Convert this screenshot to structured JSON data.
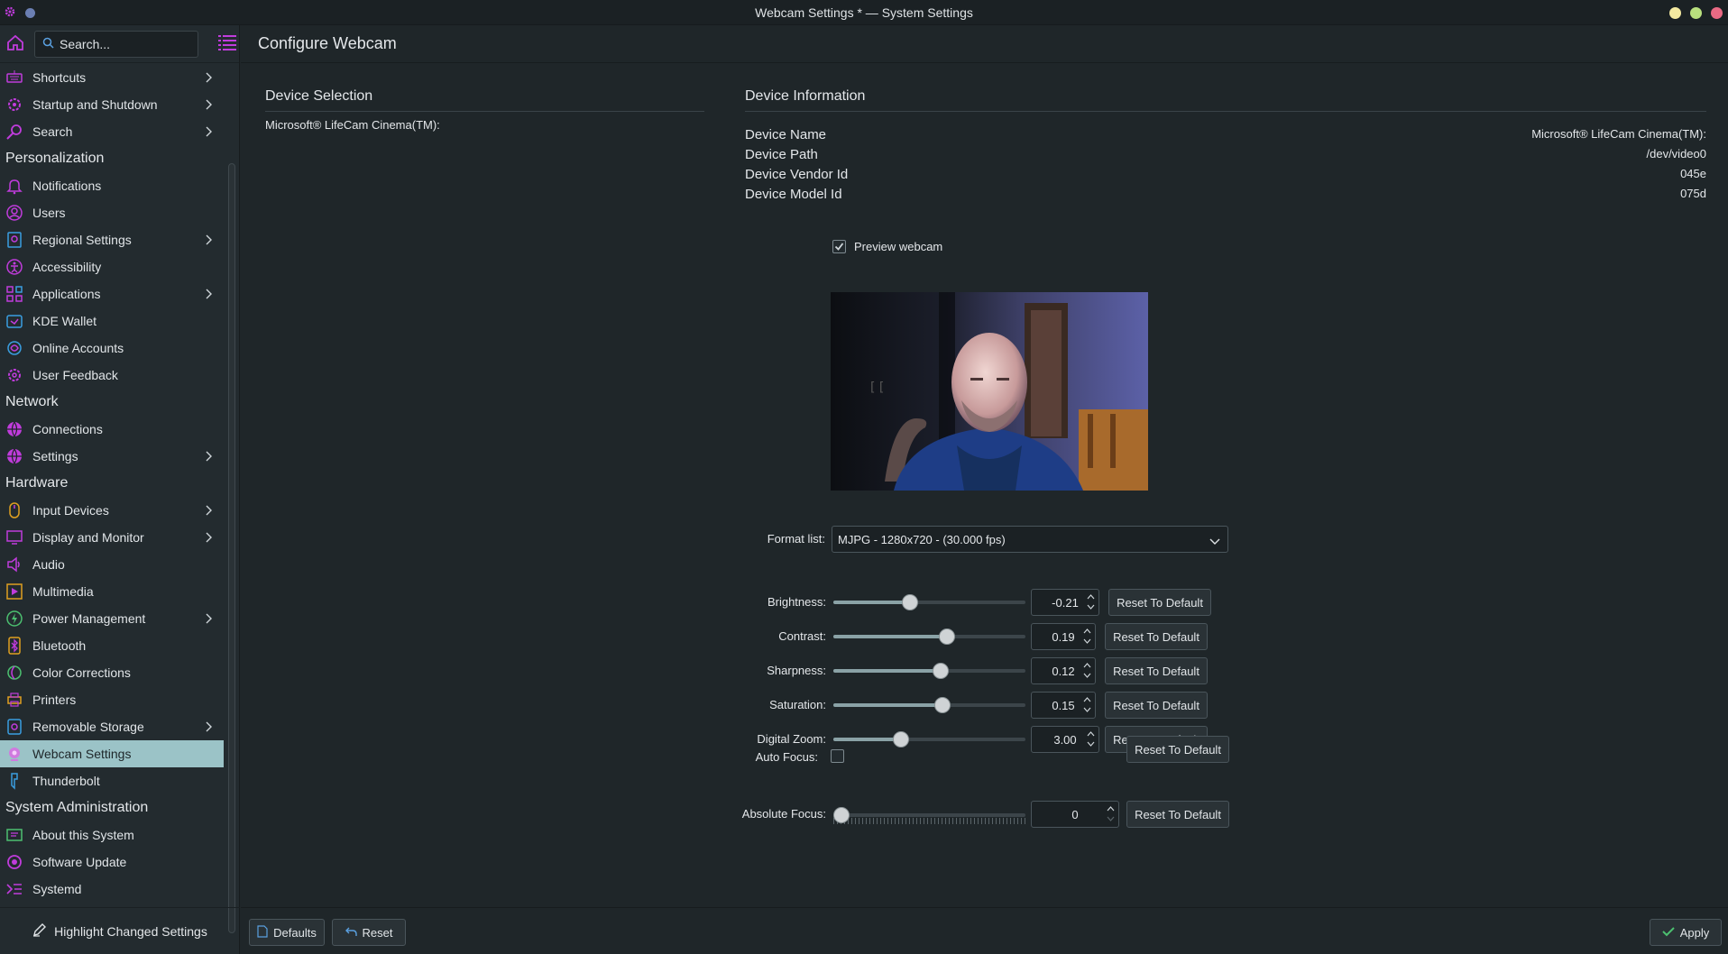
{
  "window": {
    "title": "Webcam Settings * — System Settings"
  },
  "sidebar": {
    "search_placeholder": "Search...",
    "items": [
      {
        "type": "item",
        "label": "Shortcuts",
        "icon": "keyboard-icon",
        "chevron": true
      },
      {
        "type": "item",
        "label": "Startup and Shutdown",
        "icon": "power-gear-icon",
        "chevron": true
      },
      {
        "type": "item",
        "label": "Search",
        "icon": "magnifier-icon",
        "chevron": true
      },
      {
        "type": "category",
        "label": "Personalization"
      },
      {
        "type": "item",
        "label": "Notifications",
        "icon": "bell-icon",
        "chevron": false
      },
      {
        "type": "item",
        "label": "Users",
        "icon": "user-icon",
        "chevron": false
      },
      {
        "type": "item",
        "label": "Regional Settings",
        "icon": "regional-icon",
        "chevron": true
      },
      {
        "type": "item",
        "label": "Accessibility",
        "icon": "accessibility-icon",
        "chevron": false
      },
      {
        "type": "item",
        "label": "Applications",
        "icon": "apps-grid-icon",
        "chevron": true
      },
      {
        "type": "item",
        "label": "KDE Wallet",
        "icon": "wallet-icon",
        "chevron": false
      },
      {
        "type": "item",
        "label": "Online Accounts",
        "icon": "online-accounts-icon",
        "chevron": false
      },
      {
        "type": "item",
        "label": "User Feedback",
        "icon": "feedback-icon",
        "chevron": false
      },
      {
        "type": "category",
        "label": "Network"
      },
      {
        "type": "item",
        "label": "Connections",
        "icon": "globe-icon",
        "chevron": false
      },
      {
        "type": "item",
        "label": "Settings",
        "icon": "globe-settings-icon",
        "chevron": true
      },
      {
        "type": "category",
        "label": "Hardware"
      },
      {
        "type": "item",
        "label": "Input Devices",
        "icon": "mouse-icon",
        "chevron": true
      },
      {
        "type": "item",
        "label": "Display and Monitor",
        "icon": "monitor-icon",
        "chevron": true
      },
      {
        "type": "item",
        "label": "Audio",
        "icon": "speaker-icon",
        "chevron": false
      },
      {
        "type": "item",
        "label": "Multimedia",
        "icon": "multimedia-icon",
        "chevron": false
      },
      {
        "type": "item",
        "label": "Power Management",
        "icon": "power-icon",
        "chevron": true
      },
      {
        "type": "item",
        "label": "Bluetooth",
        "icon": "bluetooth-icon",
        "chevron": false
      },
      {
        "type": "item",
        "label": "Color Corrections",
        "icon": "color-icon",
        "chevron": false
      },
      {
        "type": "item",
        "label": "Printers",
        "icon": "printer-icon",
        "chevron": false
      },
      {
        "type": "item",
        "label": "Removable Storage",
        "icon": "storage-icon",
        "chevron": true
      },
      {
        "type": "item",
        "label": "Webcam Settings",
        "icon": "webcam-icon",
        "chevron": false,
        "active": true
      },
      {
        "type": "item",
        "label": "Thunderbolt",
        "icon": "thunderbolt-icon",
        "chevron": false
      },
      {
        "type": "category",
        "label": "System Administration"
      },
      {
        "type": "item",
        "label": "About this System",
        "icon": "about-icon",
        "chevron": false
      },
      {
        "type": "item",
        "label": "Software Update",
        "icon": "update-icon",
        "chevron": false
      },
      {
        "type": "item",
        "label": "Systemd",
        "icon": "systemd-icon",
        "chevron": false
      }
    ],
    "highlight_label": "Highlight Changed Settings"
  },
  "main": {
    "page_title": "Configure Webcam",
    "device_selection": {
      "title": "Device Selection",
      "device": "Microsoft® LifeCam Cinema(TM):"
    },
    "device_info": {
      "title": "Device Information",
      "rows": [
        {
          "label": "Device Name",
          "value": "Microsoft® LifeCam Cinema(TM):"
        },
        {
          "label": "Device Path",
          "value": "/dev/video0"
        },
        {
          "label": "Device Vendor Id",
          "value": "045e"
        },
        {
          "label": "Device Model Id",
          "value": "075d"
        }
      ]
    },
    "preview_label": "Preview webcam",
    "preview_checked": true,
    "format_label": "Format list:",
    "format_value": "MJPG - 1280x720 - (30.000 fps)",
    "controls": [
      {
        "label": "Brightness:",
        "value": "-0.21",
        "level": 0.4
      },
      {
        "label": "Contrast:",
        "value": "0.19",
        "level": 0.59
      },
      {
        "label": "Sharpness:",
        "value": "0.12",
        "level": 0.56
      },
      {
        "label": "Saturation:",
        "value": "0.15",
        "level": 0.57
      },
      {
        "label": "Digital Zoom:",
        "value": "3.00",
        "level": 0.35
      }
    ],
    "auto_focus_label": "Auto Focus:",
    "auto_focus_checked": false,
    "absolute_focus_label": "Absolute Focus:",
    "absolute_focus_value": "0",
    "absolute_focus_level": 0.0,
    "reset_label": "Reset To Default"
  },
  "footer": {
    "defaults_label": "Defaults",
    "reset_label": "Reset",
    "apply_label": "Apply"
  },
  "colors": {
    "accent_icon": "#c03cdc",
    "active_bg": "#9bc3c7"
  }
}
